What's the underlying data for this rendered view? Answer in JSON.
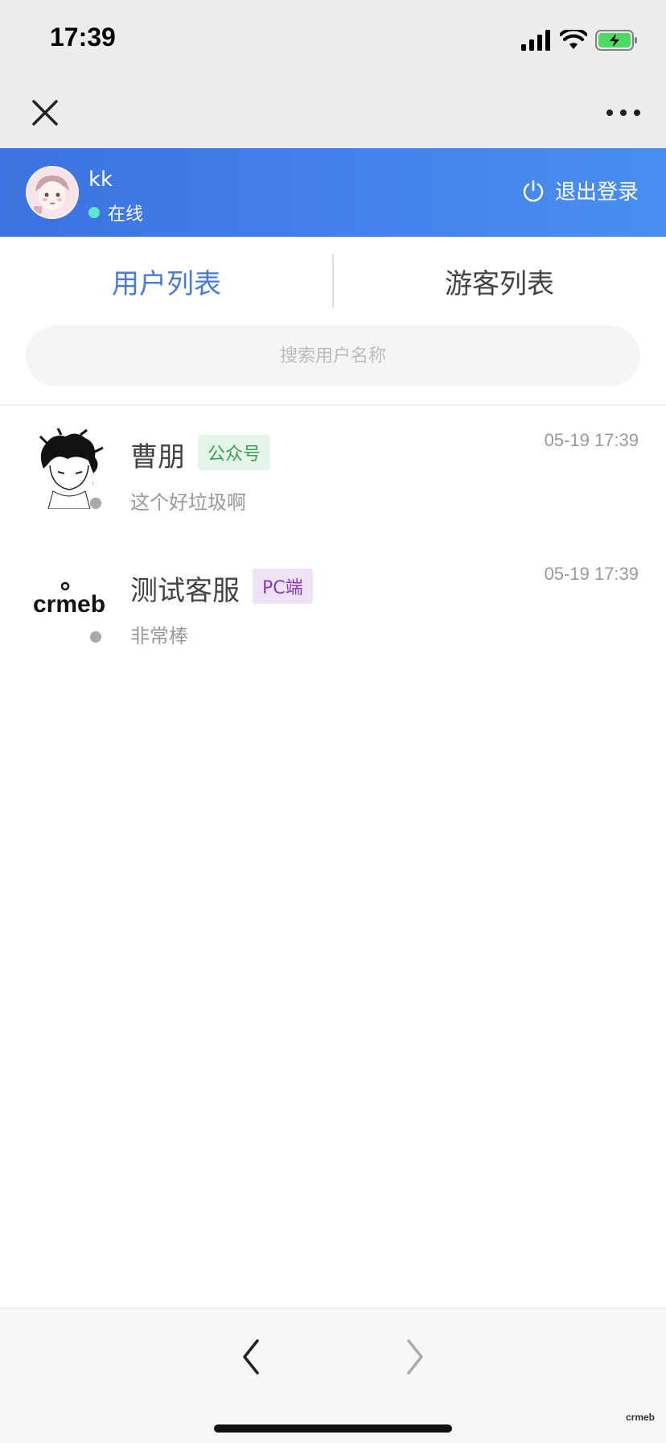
{
  "status": {
    "time": "17:39"
  },
  "header": {
    "user_name": "kk",
    "user_status": "在线",
    "logout_label": "退出登录",
    "online_color": "#5ee8c8"
  },
  "tabs": {
    "user_list": "用户列表",
    "guest_list": "游客列表",
    "active": "user_list"
  },
  "search": {
    "placeholder": "搜索用户名称"
  },
  "conversations": [
    {
      "name": "曹朋",
      "tag": "公众号",
      "message": "这个好垃圾啊",
      "time": "05-19 17:39",
      "avatar_icon": "anime-avatar-icon"
    },
    {
      "name": "测试客服",
      "tag": "PC端",
      "message": "非常棒",
      "time": "05-19 17:39",
      "avatar_icon": "crmeb-logo-icon",
      "avatar_text": "crmeb"
    }
  ],
  "watermark": "crmeb",
  "colors": {
    "header_start": "#3b73e0",
    "header_end": "#4a8ef0",
    "active_tab": "#4a7ad2"
  }
}
